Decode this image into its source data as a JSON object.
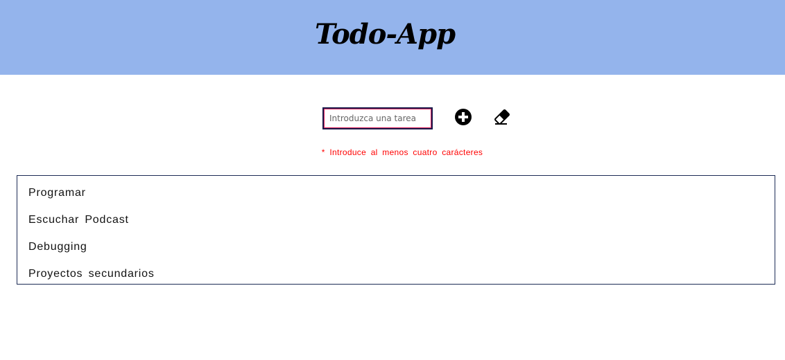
{
  "header": {
    "title": "Todo-App"
  },
  "form": {
    "input_placeholder": "Introduzca una tarea",
    "input_value": "",
    "add_icon": "plus-circle-icon",
    "clear_icon": "eraser-icon",
    "validation_message": "* Introduce al menos cuatro carácteres"
  },
  "tasks": [
    {
      "label": "Programar"
    },
    {
      "label": "Escuchar Podcast"
    },
    {
      "label": "Debugging"
    },
    {
      "label": "Proyectos secundarios"
    }
  ],
  "colors": {
    "header_bg": "#94b4ec",
    "error": "#ff0000",
    "list_border": "#1c2b55"
  }
}
